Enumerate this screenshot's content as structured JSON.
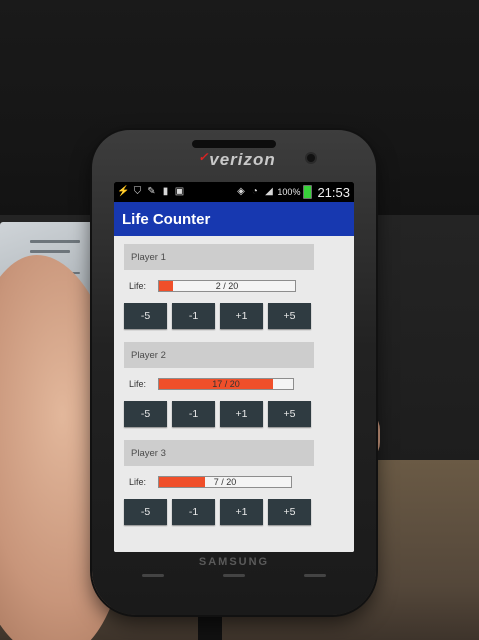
{
  "phone": {
    "carrier": "verizon",
    "manufacturer": "SAMSUNG"
  },
  "statusbar": {
    "battery_percent": "100%",
    "time": "21:53"
  },
  "app": {
    "title": "Life Counter"
  },
  "labels": {
    "life": "Life:"
  },
  "buttons": [
    "-5",
    "-1",
    "+1",
    "+5"
  ],
  "players": [
    {
      "name": "Player 1",
      "life": 2,
      "max": 20,
      "life_text": "2 / 20",
      "fill_fraction": 0.1
    },
    {
      "name": "Player 2",
      "life": 17,
      "max": 20,
      "life_text": "17 / 20",
      "fill_fraction": 0.85
    },
    {
      "name": "Player 3",
      "life": 7,
      "max": 20,
      "life_text": "7 / 20",
      "fill_fraction": 0.35
    }
  ],
  "colors": {
    "app_bar": "#1738b0",
    "life_fill": "#f04f2a",
    "button_bg": "#2f3b41"
  }
}
